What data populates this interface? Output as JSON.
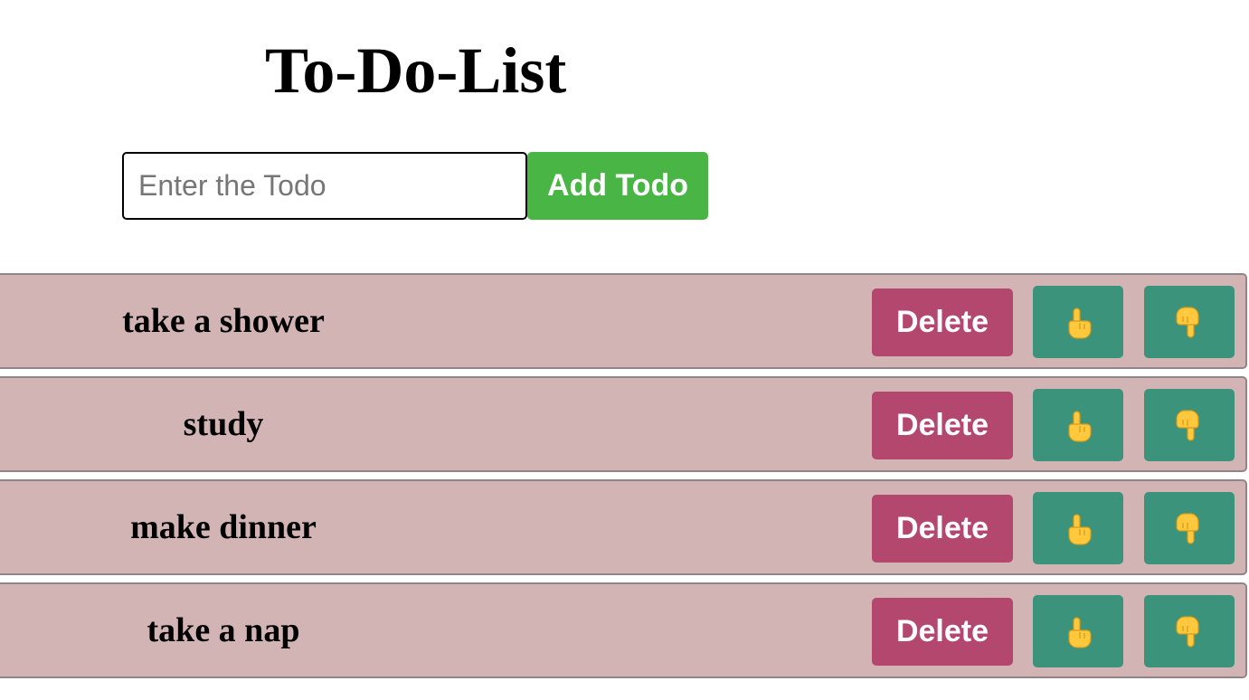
{
  "header": {
    "title": "To-Do-List"
  },
  "form": {
    "input_placeholder": "Enter the Todo",
    "input_value": "",
    "add_label": "Add Todo"
  },
  "todos": [
    {
      "text": "take a shower",
      "delete_label": "Delete",
      "up_icon": "pointing-up-icon",
      "down_icon": "pointing-down-icon"
    },
    {
      "text": "study",
      "delete_label": "Delete",
      "up_icon": "pointing-up-icon",
      "down_icon": "pointing-down-icon"
    },
    {
      "text": "make dinner",
      "delete_label": "Delete",
      "up_icon": "pointing-up-icon",
      "down_icon": "pointing-down-icon"
    },
    {
      "text": "take a nap",
      "delete_label": "Delete",
      "up_icon": "pointing-up-icon",
      "down_icon": "pointing-down-icon"
    }
  ],
  "colors": {
    "add_button": "#48b545",
    "delete_button": "#b4476d",
    "move_button": "#3a937a",
    "row_background": "#d3b4b5",
    "hand_icon": "#ffc83d"
  }
}
